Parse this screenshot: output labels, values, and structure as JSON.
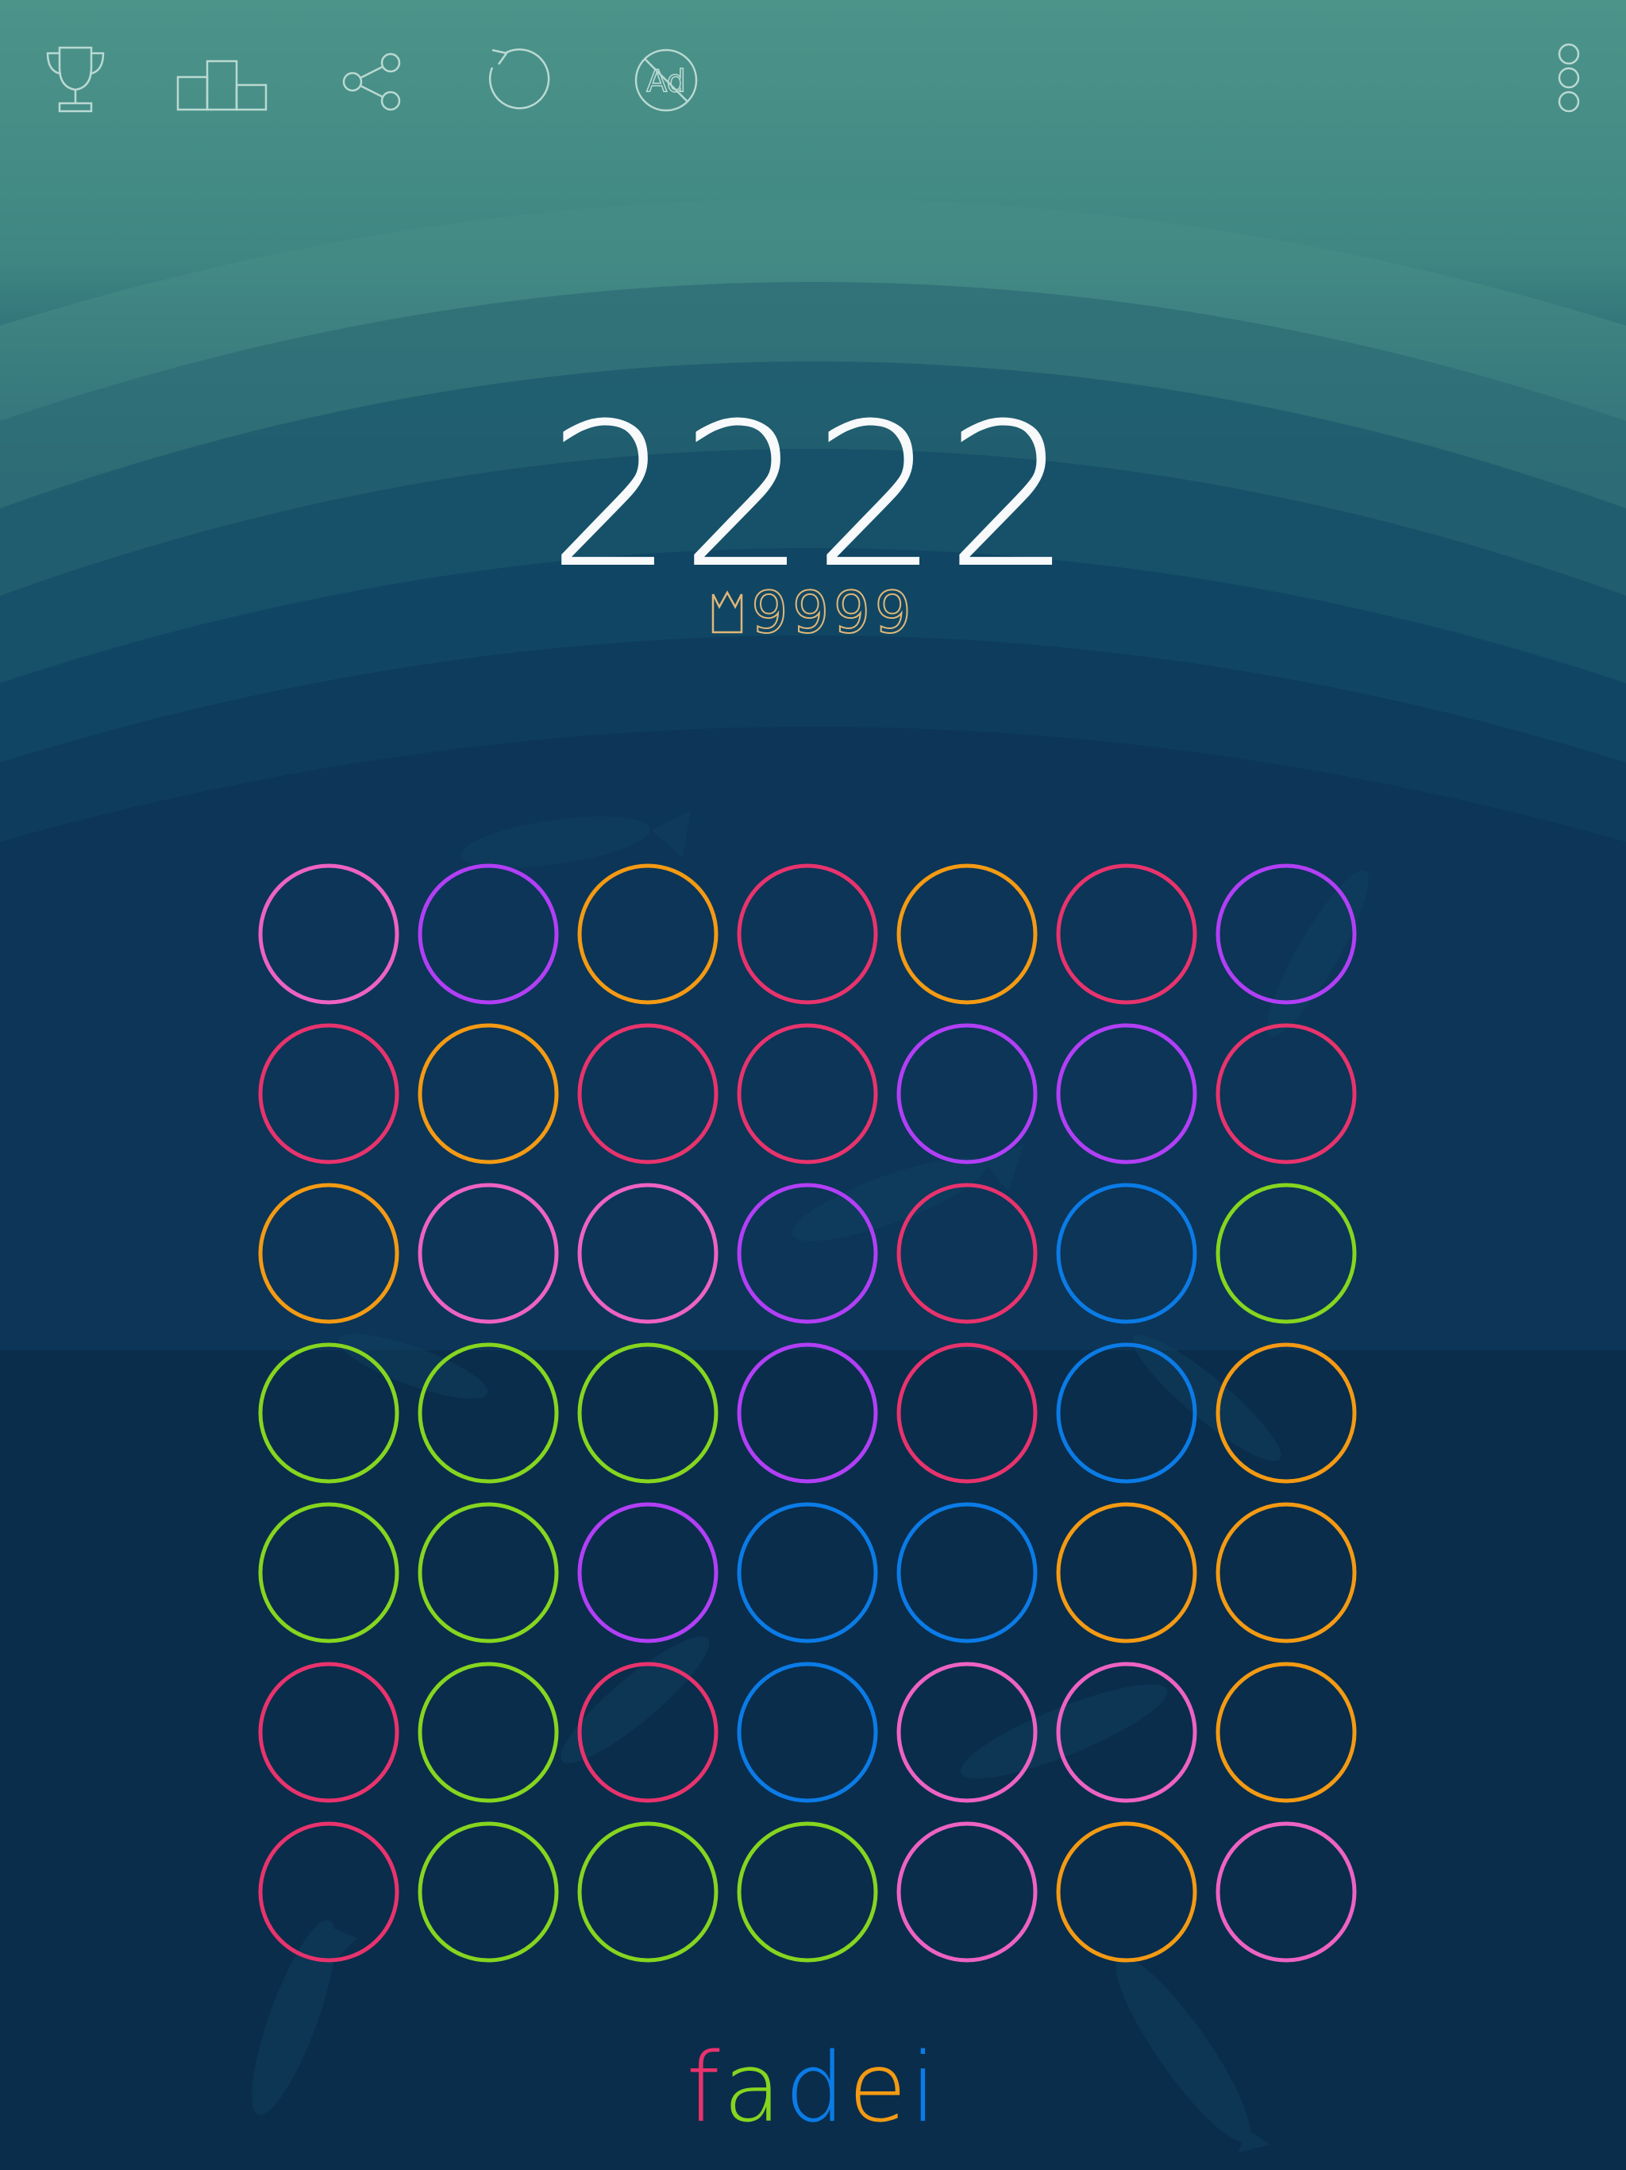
{
  "toolbar": {
    "icons": [
      "trophy-icon",
      "leaderboard-icon",
      "share-icon",
      "restart-icon",
      "no-ads-icon",
      "more-options-icon"
    ],
    "ad_glyph": "Ad"
  },
  "score": {
    "current": "2222",
    "best": "9999"
  },
  "colors": {
    "pink": "#ee62c2",
    "purple": "#b23ff6",
    "orange": "#f49a13",
    "red": "#e8336d",
    "blue": "#0b7be6",
    "green": "#86d51f",
    "best_gold": "#e0b779",
    "bg_top": "#4c948a",
    "bg_bottom": "#08223a"
  },
  "board": {
    "rows": [
      [
        "pink",
        "purple",
        "orange",
        "red",
        "orange",
        "red",
        "purple"
      ],
      [
        "red",
        "orange",
        "red",
        "red",
        "purple",
        "purple",
        "red"
      ],
      [
        "orange",
        "pink",
        "pink",
        "purple",
        "red",
        "blue",
        "green"
      ],
      [
        "green",
        "green",
        "green",
        "purple",
        "red",
        "blue",
        "orange"
      ],
      [
        "green",
        "green",
        "purple",
        "blue",
        "blue",
        "orange",
        "orange"
      ],
      [
        "red",
        "green",
        "red",
        "blue",
        "pink",
        "pink",
        "orange"
      ],
      [
        "red",
        "green",
        "green",
        "green",
        "pink",
        "orange",
        "pink"
      ]
    ]
  },
  "logo": {
    "letters": [
      "f",
      "a",
      "d",
      "e",
      "i"
    ],
    "letter_colors": [
      "red",
      "green",
      "blue",
      "orange",
      "blue"
    ]
  }
}
